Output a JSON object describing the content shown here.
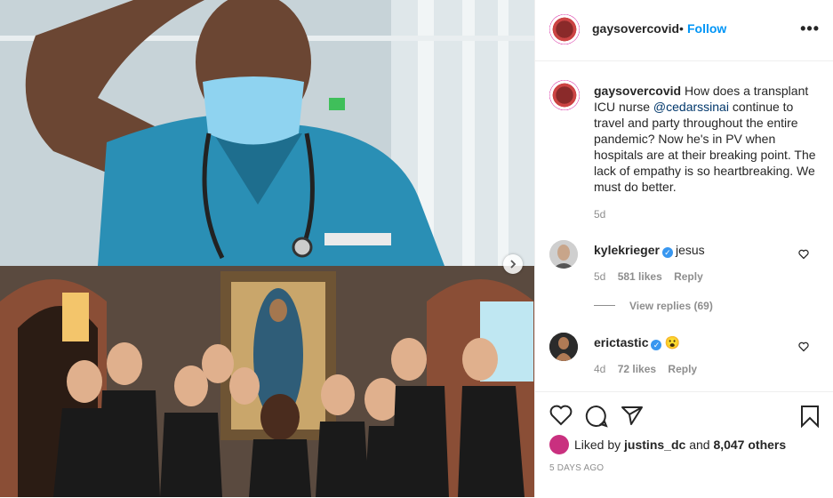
{
  "post": {
    "username": "gaysovercovid",
    "follow_label": "Follow",
    "separator": "•",
    "more_icon": "more-horizontal-icon"
  },
  "caption": {
    "username": "gaysovercovid",
    "text_before": "How does a transplant ICU nurse",
    "mention": "@cedarssinai",
    "text_after": "continue to travel and party throughout the entire pandemic? Now he's in PV when hospitals are at their breaking point. The lack of empathy is so heartbreaking. We must do better.",
    "time": "5d"
  },
  "comments": [
    {
      "username": "kylekrieger",
      "text": "jesus",
      "time": "5d",
      "likes": "581 likes",
      "reply": "Reply",
      "view_replies": "View replies (69)"
    },
    {
      "username": "erictastic",
      "text": "😮",
      "time": "4d",
      "likes": "72 likes",
      "reply": "Reply"
    }
  ],
  "likes": {
    "prefix": "Liked by",
    "user": "justins_dc",
    "middle": "and",
    "count": "8,047 others"
  },
  "posted": "5 DAYS AGO",
  "colors": {
    "link": "#0095f6",
    "mention": "#00376b",
    "meta": "#8e8e8e",
    "border": "#efefef"
  }
}
